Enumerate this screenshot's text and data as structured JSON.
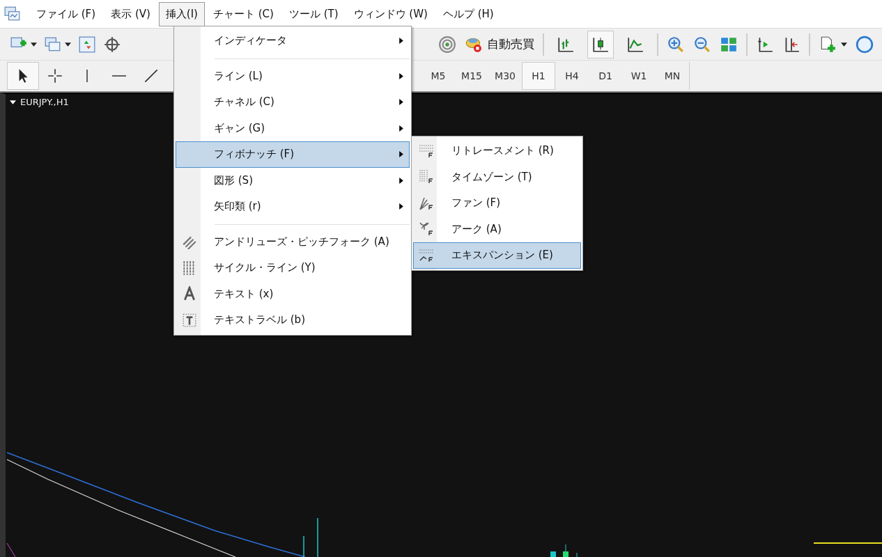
{
  "menubar": [
    {
      "label": "ファイル (F)",
      "selected": false
    },
    {
      "label": "表示 (V)",
      "selected": false
    },
    {
      "label": "挿入(I)",
      "selected": true
    },
    {
      "label": "チャート (C)",
      "selected": false
    },
    {
      "label": "ツール (T)",
      "selected": false
    },
    {
      "label": "ウィンドウ (W)",
      "selected": false
    },
    {
      "label": "ヘルプ (H)",
      "selected": false
    }
  ],
  "toolbar": {
    "autotrade_label": "自動売買",
    "chart_types": [
      {
        "kind": "bar",
        "selected": false
      },
      {
        "kind": "candle",
        "selected": true
      },
      {
        "kind": "line",
        "selected": false
      }
    ]
  },
  "draw_tools": [
    {
      "kind": "cursor",
      "selected": true
    },
    {
      "kind": "crosshair",
      "selected": false
    },
    {
      "kind": "vline",
      "selected": false
    },
    {
      "kind": "hline",
      "selected": false
    },
    {
      "kind": "trendline",
      "selected": false
    }
  ],
  "timeframes": [
    {
      "label": "M5",
      "selected": false
    },
    {
      "label": "M15",
      "selected": false
    },
    {
      "label": "M30",
      "selected": false
    },
    {
      "label": "H1",
      "selected": true
    },
    {
      "label": "H4",
      "selected": false
    },
    {
      "label": "D1",
      "selected": false
    },
    {
      "label": "W1",
      "selected": false
    },
    {
      "label": "MN",
      "selected": false
    }
  ],
  "chart": {
    "symbol": "EURJPY.,H1"
  },
  "insert_menu": [
    {
      "kind": "submenu",
      "label": "インディケータ",
      "selected": false
    },
    {
      "kind": "separator"
    },
    {
      "kind": "submenu",
      "label": "ライン (L)",
      "selected": false
    },
    {
      "kind": "submenu",
      "label": "チャネル (C)",
      "selected": false
    },
    {
      "kind": "submenu",
      "label": "ギャン (G)",
      "selected": false
    },
    {
      "kind": "submenu",
      "label": "フィボナッチ (F)",
      "selected": true
    },
    {
      "kind": "submenu",
      "label": "図形 (S)",
      "selected": false
    },
    {
      "kind": "submenu",
      "label": "矢印類 (r)",
      "selected": false
    },
    {
      "kind": "separator"
    },
    {
      "kind": "pitchfork",
      "label": "アンドリューズ・ピッチフォーク (A)",
      "selected": false
    },
    {
      "kind": "cycle",
      "label": "サイクル・ライン (Y)",
      "selected": false
    },
    {
      "kind": "text",
      "label": "テキスト (x)",
      "selected": false
    },
    {
      "kind": "label",
      "label": "テキストラベル (b)",
      "selected": false
    }
  ],
  "fibonacci_menu": [
    {
      "kind": "retracement",
      "label": "リトレースメント (R)",
      "selected": false
    },
    {
      "kind": "timezone",
      "label": "タイムゾーン (T)",
      "selected": false
    },
    {
      "kind": "fan",
      "label": "ファン (F)",
      "selected": false
    },
    {
      "kind": "arc",
      "label": "アーク (A)",
      "selected": false
    },
    {
      "kind": "expansion",
      "label": "エキスパンション (E)",
      "selected": true
    }
  ]
}
